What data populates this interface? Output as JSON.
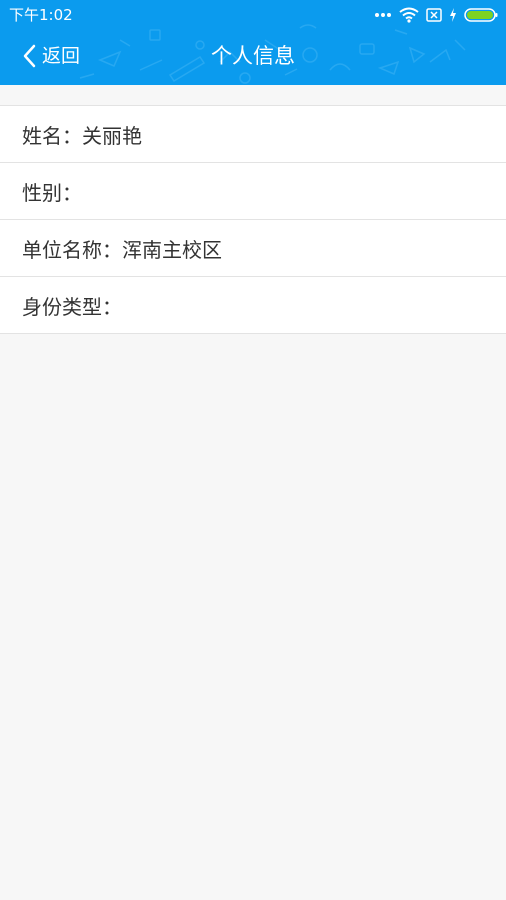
{
  "status_bar": {
    "time": "下午1:02",
    "icons": [
      "dots-icon",
      "wifi-icon",
      "no-sim-icon",
      "charging-icon",
      "battery-icon"
    ],
    "battery_color": "#7ed321"
  },
  "nav": {
    "back_label": "返回",
    "title": "个人信息",
    "background_color": "#0b9bee"
  },
  "profile": {
    "rows": [
      {
        "label": "姓名：",
        "value": "关丽艳"
      },
      {
        "label": "性别：",
        "value": ""
      },
      {
        "label": "单位名称：",
        "value": "浑南主校区"
      },
      {
        "label": "身份类型：",
        "value": ""
      }
    ]
  }
}
